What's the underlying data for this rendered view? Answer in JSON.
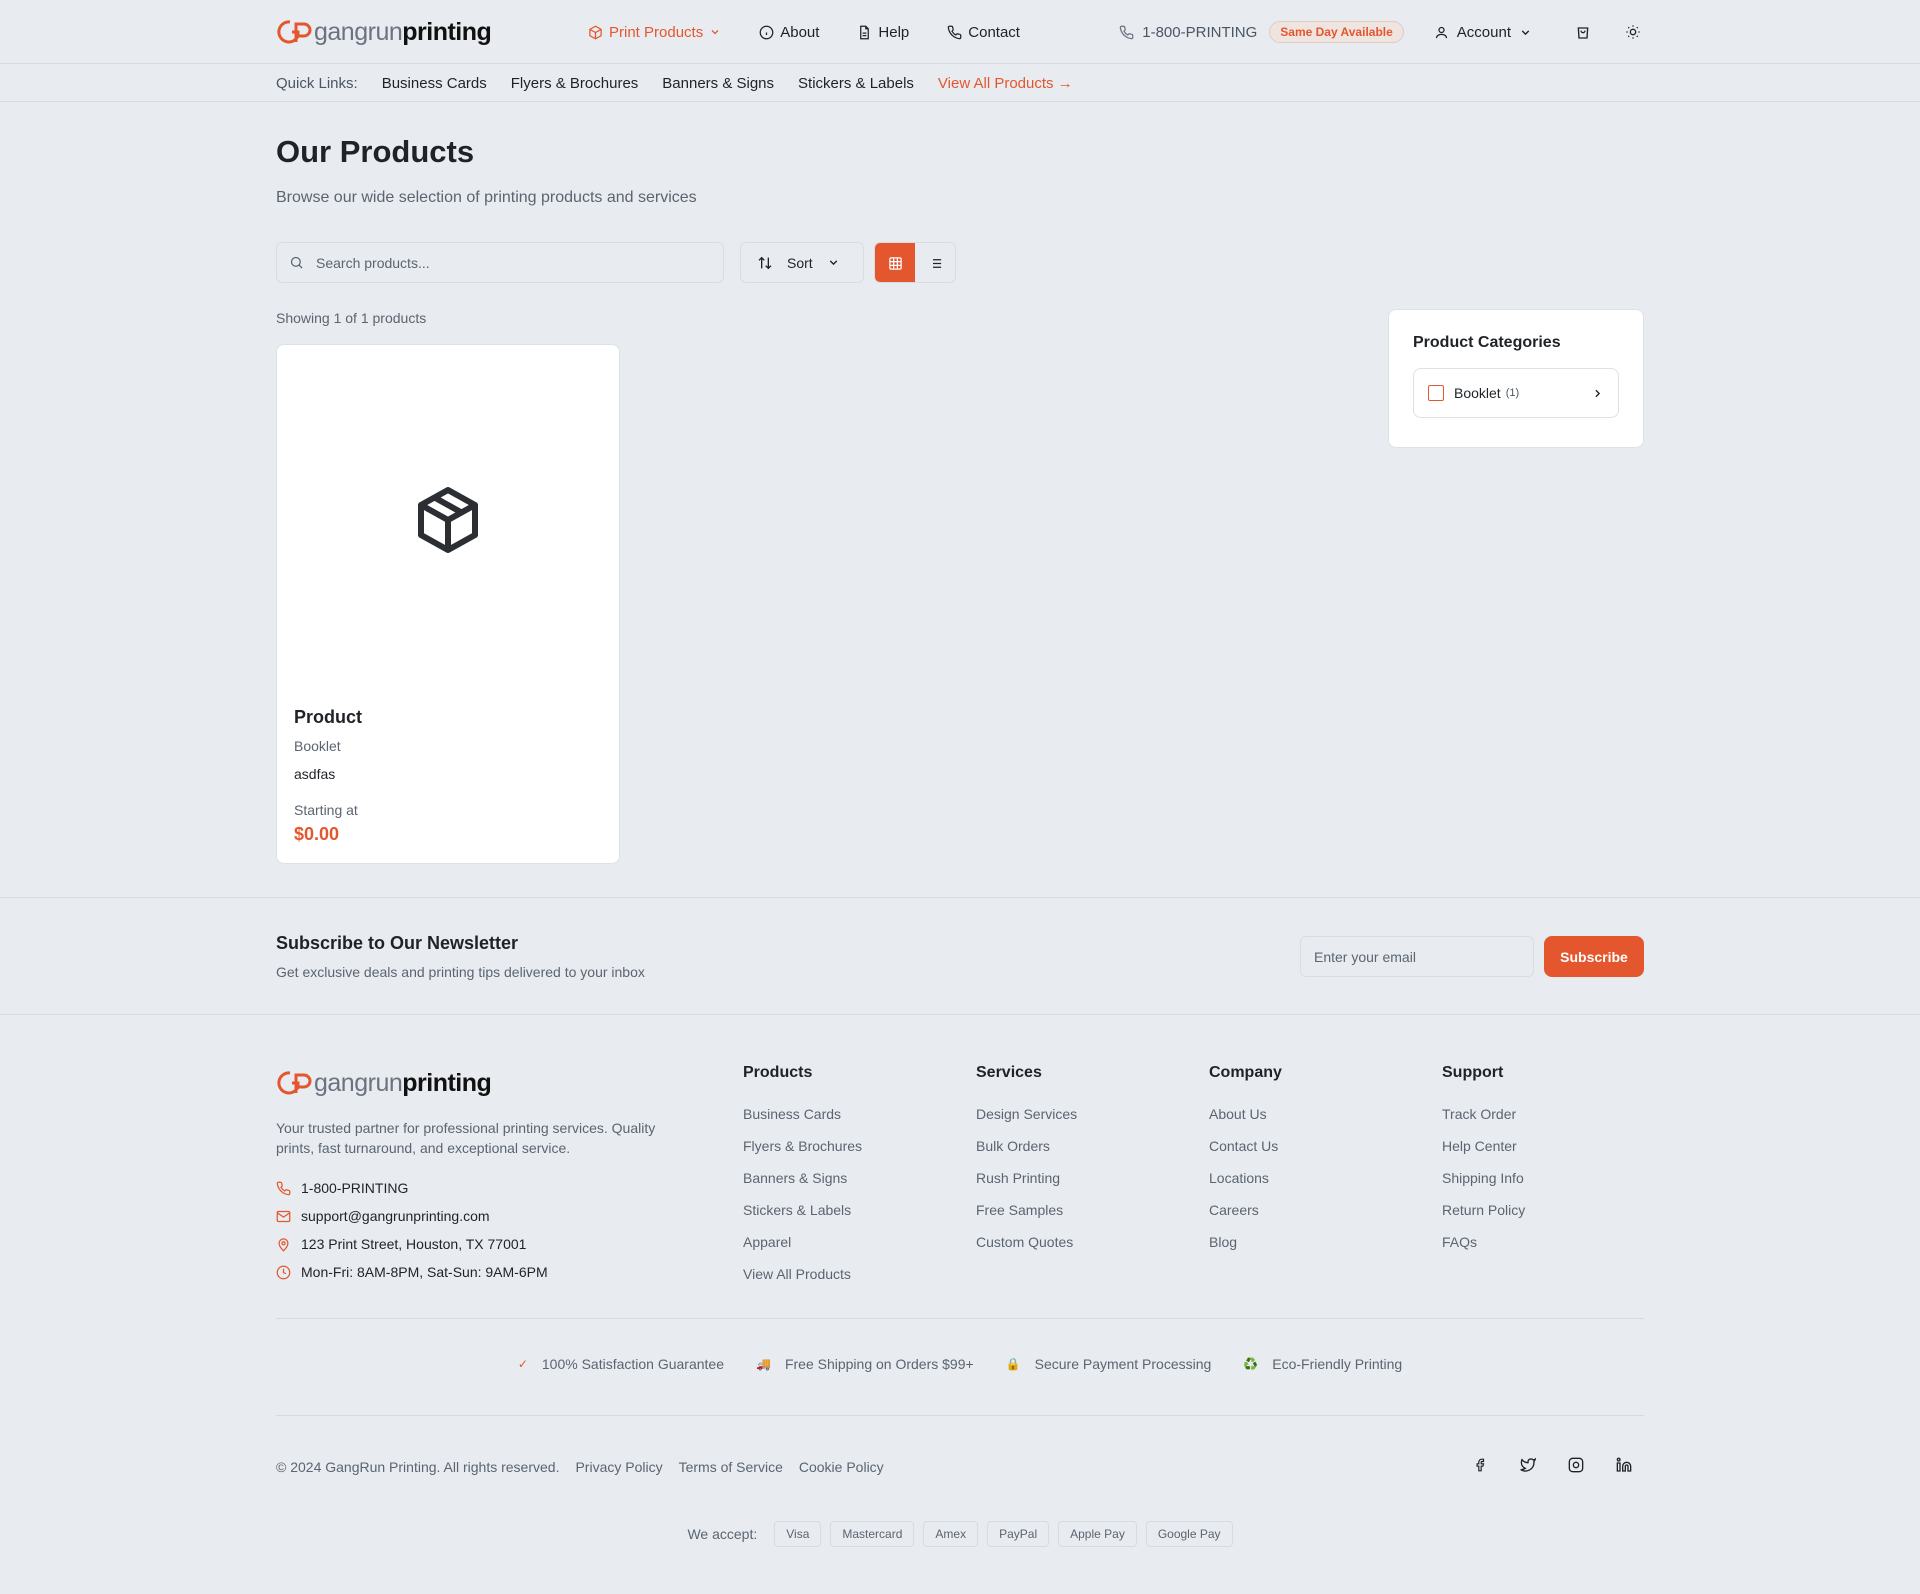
{
  "brand": {
    "name_part1": "gangrun",
    "name_part2": "printing",
    "accent": "#e4572e"
  },
  "nav": {
    "items": [
      {
        "label": "Print Products",
        "icon": "package-icon",
        "active": true
      },
      {
        "label": "About",
        "icon": "info-icon"
      },
      {
        "label": "Help",
        "icon": "document-icon"
      },
      {
        "label": "Contact",
        "icon": "phone-icon"
      }
    ],
    "phone": "1-800-PRINTING",
    "badge": "Same Day Available",
    "account": "Account"
  },
  "quick_links": {
    "label": "Quick Links:",
    "items": [
      "Business Cards",
      "Flyers & Brochures",
      "Banners & Signs",
      "Stickers & Labels"
    ],
    "view_all": "View All Products →"
  },
  "page": {
    "title": "Our Products",
    "subtitle": "Browse our wide selection of printing products and services",
    "search_placeholder": "Search products...",
    "sort_label": "Sort",
    "showing": "Showing 1 of 1 products"
  },
  "products": [
    {
      "title": "Product",
      "category": "Booklet",
      "description": "asdfas",
      "price_label": "Starting at",
      "price": "$0.00"
    }
  ],
  "categories": {
    "title": "Product Categories",
    "items": [
      {
        "name": "Booklet",
        "count": "(1)"
      }
    ]
  },
  "newsletter": {
    "title": "Subscribe to Our Newsletter",
    "subtitle": "Get exclusive deals and printing tips delivered to your inbox",
    "placeholder": "Enter your email",
    "button": "Subscribe"
  },
  "footer": {
    "description": "Your trusted partner for professional printing services. Quality prints, fast turnaround, and exceptional service.",
    "contact": {
      "phone": "1-800-PRINTING",
      "email": "support@gangrunprinting.com",
      "address": "123 Print Street, Houston, TX 77001",
      "hours": "Mon-Fri: 8AM-8PM, Sat-Sun: 9AM-6PM"
    },
    "columns": [
      {
        "title": "Products",
        "links": [
          "Business Cards",
          "Flyers & Brochures",
          "Banners & Signs",
          "Stickers & Labels",
          "Apparel",
          "View All Products"
        ]
      },
      {
        "title": "Services",
        "links": [
          "Design Services",
          "Bulk Orders",
          "Rush Printing",
          "Free Samples",
          "Custom Quotes"
        ]
      },
      {
        "title": "Company",
        "links": [
          "About Us",
          "Contact Us",
          "Locations",
          "Careers",
          "Blog"
        ]
      },
      {
        "title": "Support",
        "links": [
          "Track Order",
          "Help Center",
          "Shipping Info",
          "Return Policy",
          "FAQs"
        ]
      }
    ],
    "trust": [
      {
        "icon": "✓",
        "text": "100% Satisfaction Guarantee"
      },
      {
        "icon": "🚚",
        "text": "Free Shipping on Orders $99+"
      },
      {
        "icon": "🔒",
        "text": "Secure Payment Processing"
      },
      {
        "icon": "♻️",
        "text": "Eco-Friendly Printing"
      }
    ],
    "copyright": "© 2024 GangRun Printing. All rights reserved.",
    "legal": [
      "Privacy Policy",
      "Terms of Service",
      "Cookie Policy"
    ],
    "accept_label": "We accept:",
    "payments": [
      "Visa",
      "Mastercard",
      "Amex",
      "PayPal",
      "Apple Pay",
      "Google Pay"
    ]
  }
}
